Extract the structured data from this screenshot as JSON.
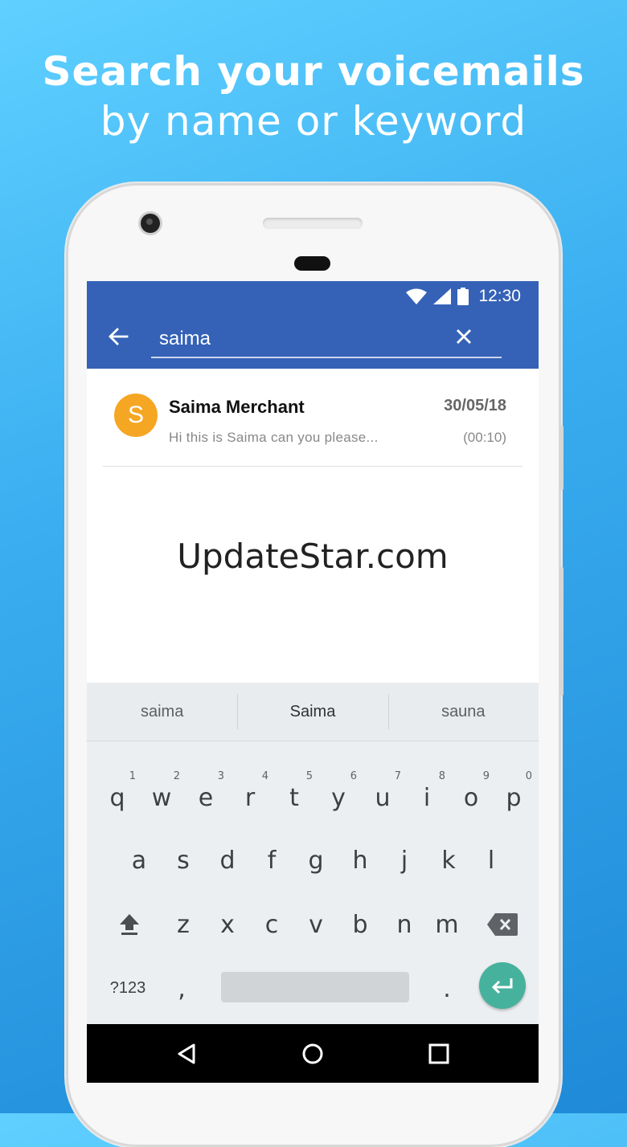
{
  "headline": {
    "line1": "Search your voicemails",
    "line2": "by name or keyword"
  },
  "status": {
    "time": "12:30",
    "icons": [
      "wifi-icon",
      "signal-icon",
      "battery-icon"
    ]
  },
  "search": {
    "value": "saima",
    "back_icon": "arrow-left-icon",
    "clear_icon": "close-icon"
  },
  "results": [
    {
      "avatar_letter": "S",
      "name": "Saima Merchant",
      "date": "30/05/18",
      "preview": "Hi this is Saima can you please...",
      "duration": "(00:10)",
      "avatar_color": "#f5a623"
    }
  ],
  "watermark": "UpdateStar.com",
  "suggestions": [
    "saima",
    "Saima",
    "sauna"
  ],
  "keyboard": {
    "row1": [
      {
        "k": "q",
        "n": "1"
      },
      {
        "k": "w",
        "n": "2"
      },
      {
        "k": "e",
        "n": "3"
      },
      {
        "k": "r",
        "n": "4"
      },
      {
        "k": "t",
        "n": "5"
      },
      {
        "k": "y",
        "n": "6"
      },
      {
        "k": "u",
        "n": "7"
      },
      {
        "k": "i",
        "n": "8"
      },
      {
        "k": "o",
        "n": "9"
      },
      {
        "k": "p",
        "n": "0"
      }
    ],
    "row2": [
      "a",
      "s",
      "d",
      "f",
      "g",
      "h",
      "j",
      "k",
      "l"
    ],
    "row3": [
      "z",
      "x",
      "c",
      "v",
      "b",
      "n",
      "m"
    ],
    "symbols_label": "?123",
    "comma": ",",
    "period": "."
  },
  "colors": {
    "appbar": "#3562b7",
    "avatar": "#f5a623",
    "enter": "#46b29d"
  }
}
